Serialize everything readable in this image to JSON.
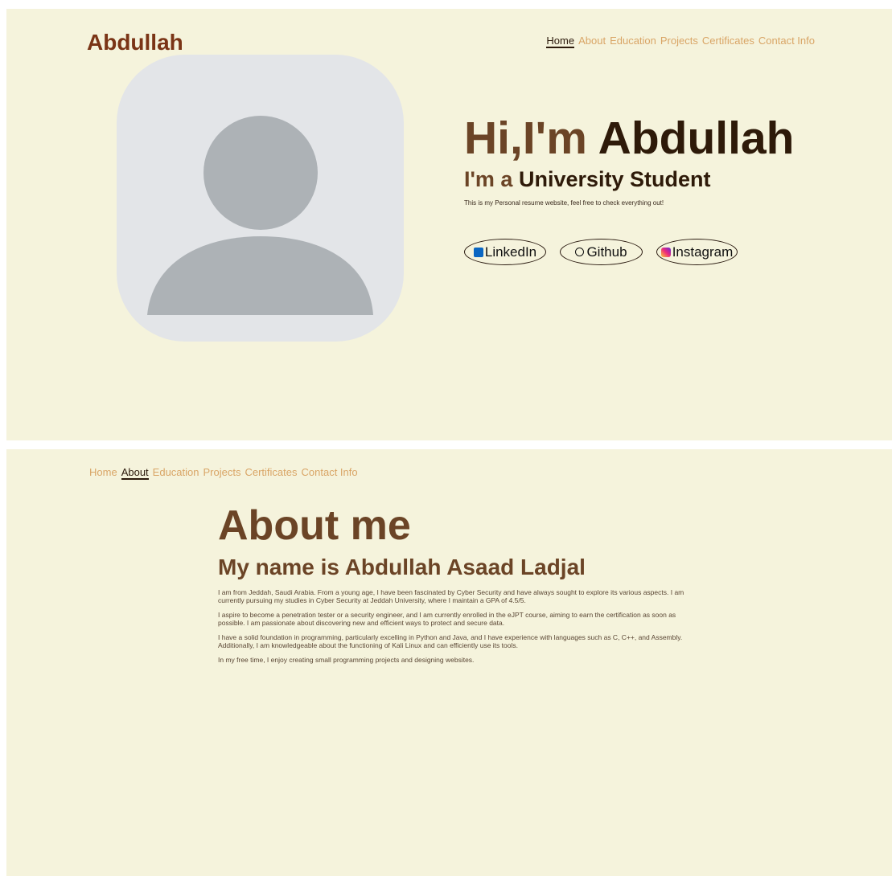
{
  "hero": {
    "logo": "Abdullah",
    "nav": [
      "Home",
      "About",
      "Education",
      "Projects",
      "Certificates",
      "Contact Info"
    ],
    "greeting_prefix": "Hi,I'm",
    "greeting_name": "Abdullah",
    "role_prefix": "I'm a",
    "role": "University Student",
    "tagline": "This is my Personal resume website, feel free to check everything out!",
    "socials": [
      {
        "label": "LinkedIn",
        "icon": "linkedin-icon"
      },
      {
        "label": "Github",
        "icon": "github-icon"
      },
      {
        "label": "Instagram",
        "icon": "instagram-icon"
      }
    ]
  },
  "about": {
    "nav": [
      "Home",
      "About",
      "Education",
      "Projects",
      "Certificates",
      "Contact Info"
    ],
    "title": "About me",
    "name_line": "My name is Abdullah Asaad Ladjal",
    "paragraphs": [
      "I am from Jeddah, Saudi Arabia. From a young age, I have been fascinated by Cyber Security and have always sought to explore its various aspects. I am currently pursuing my studies in Cyber Security at Jeddah University, where I maintain a GPA of 4.5/5.",
      "I aspire to become a penetration tester or a security engineer, and I am currently enrolled in the eJPT course, aiming to earn the certification as soon as possible. I am passionate about discovering new and efficient ways to protect and secure data.",
      "I have a solid foundation in programming, particularly excelling in Python and Java, and I have experience with languages such as C, C++, and Assembly. Additionally, I am knowledgeable about the functioning of Kali Linux and can efficiently use its tools.",
      "In my free time, I enjoy creating small programming projects and designing websites."
    ]
  },
  "colors": {
    "background": "#f5f3dc",
    "logo": "#7a3416",
    "heading_brown": "#6b4426",
    "heading_dark": "#2e1a09",
    "nav_link": "#d9a566"
  }
}
